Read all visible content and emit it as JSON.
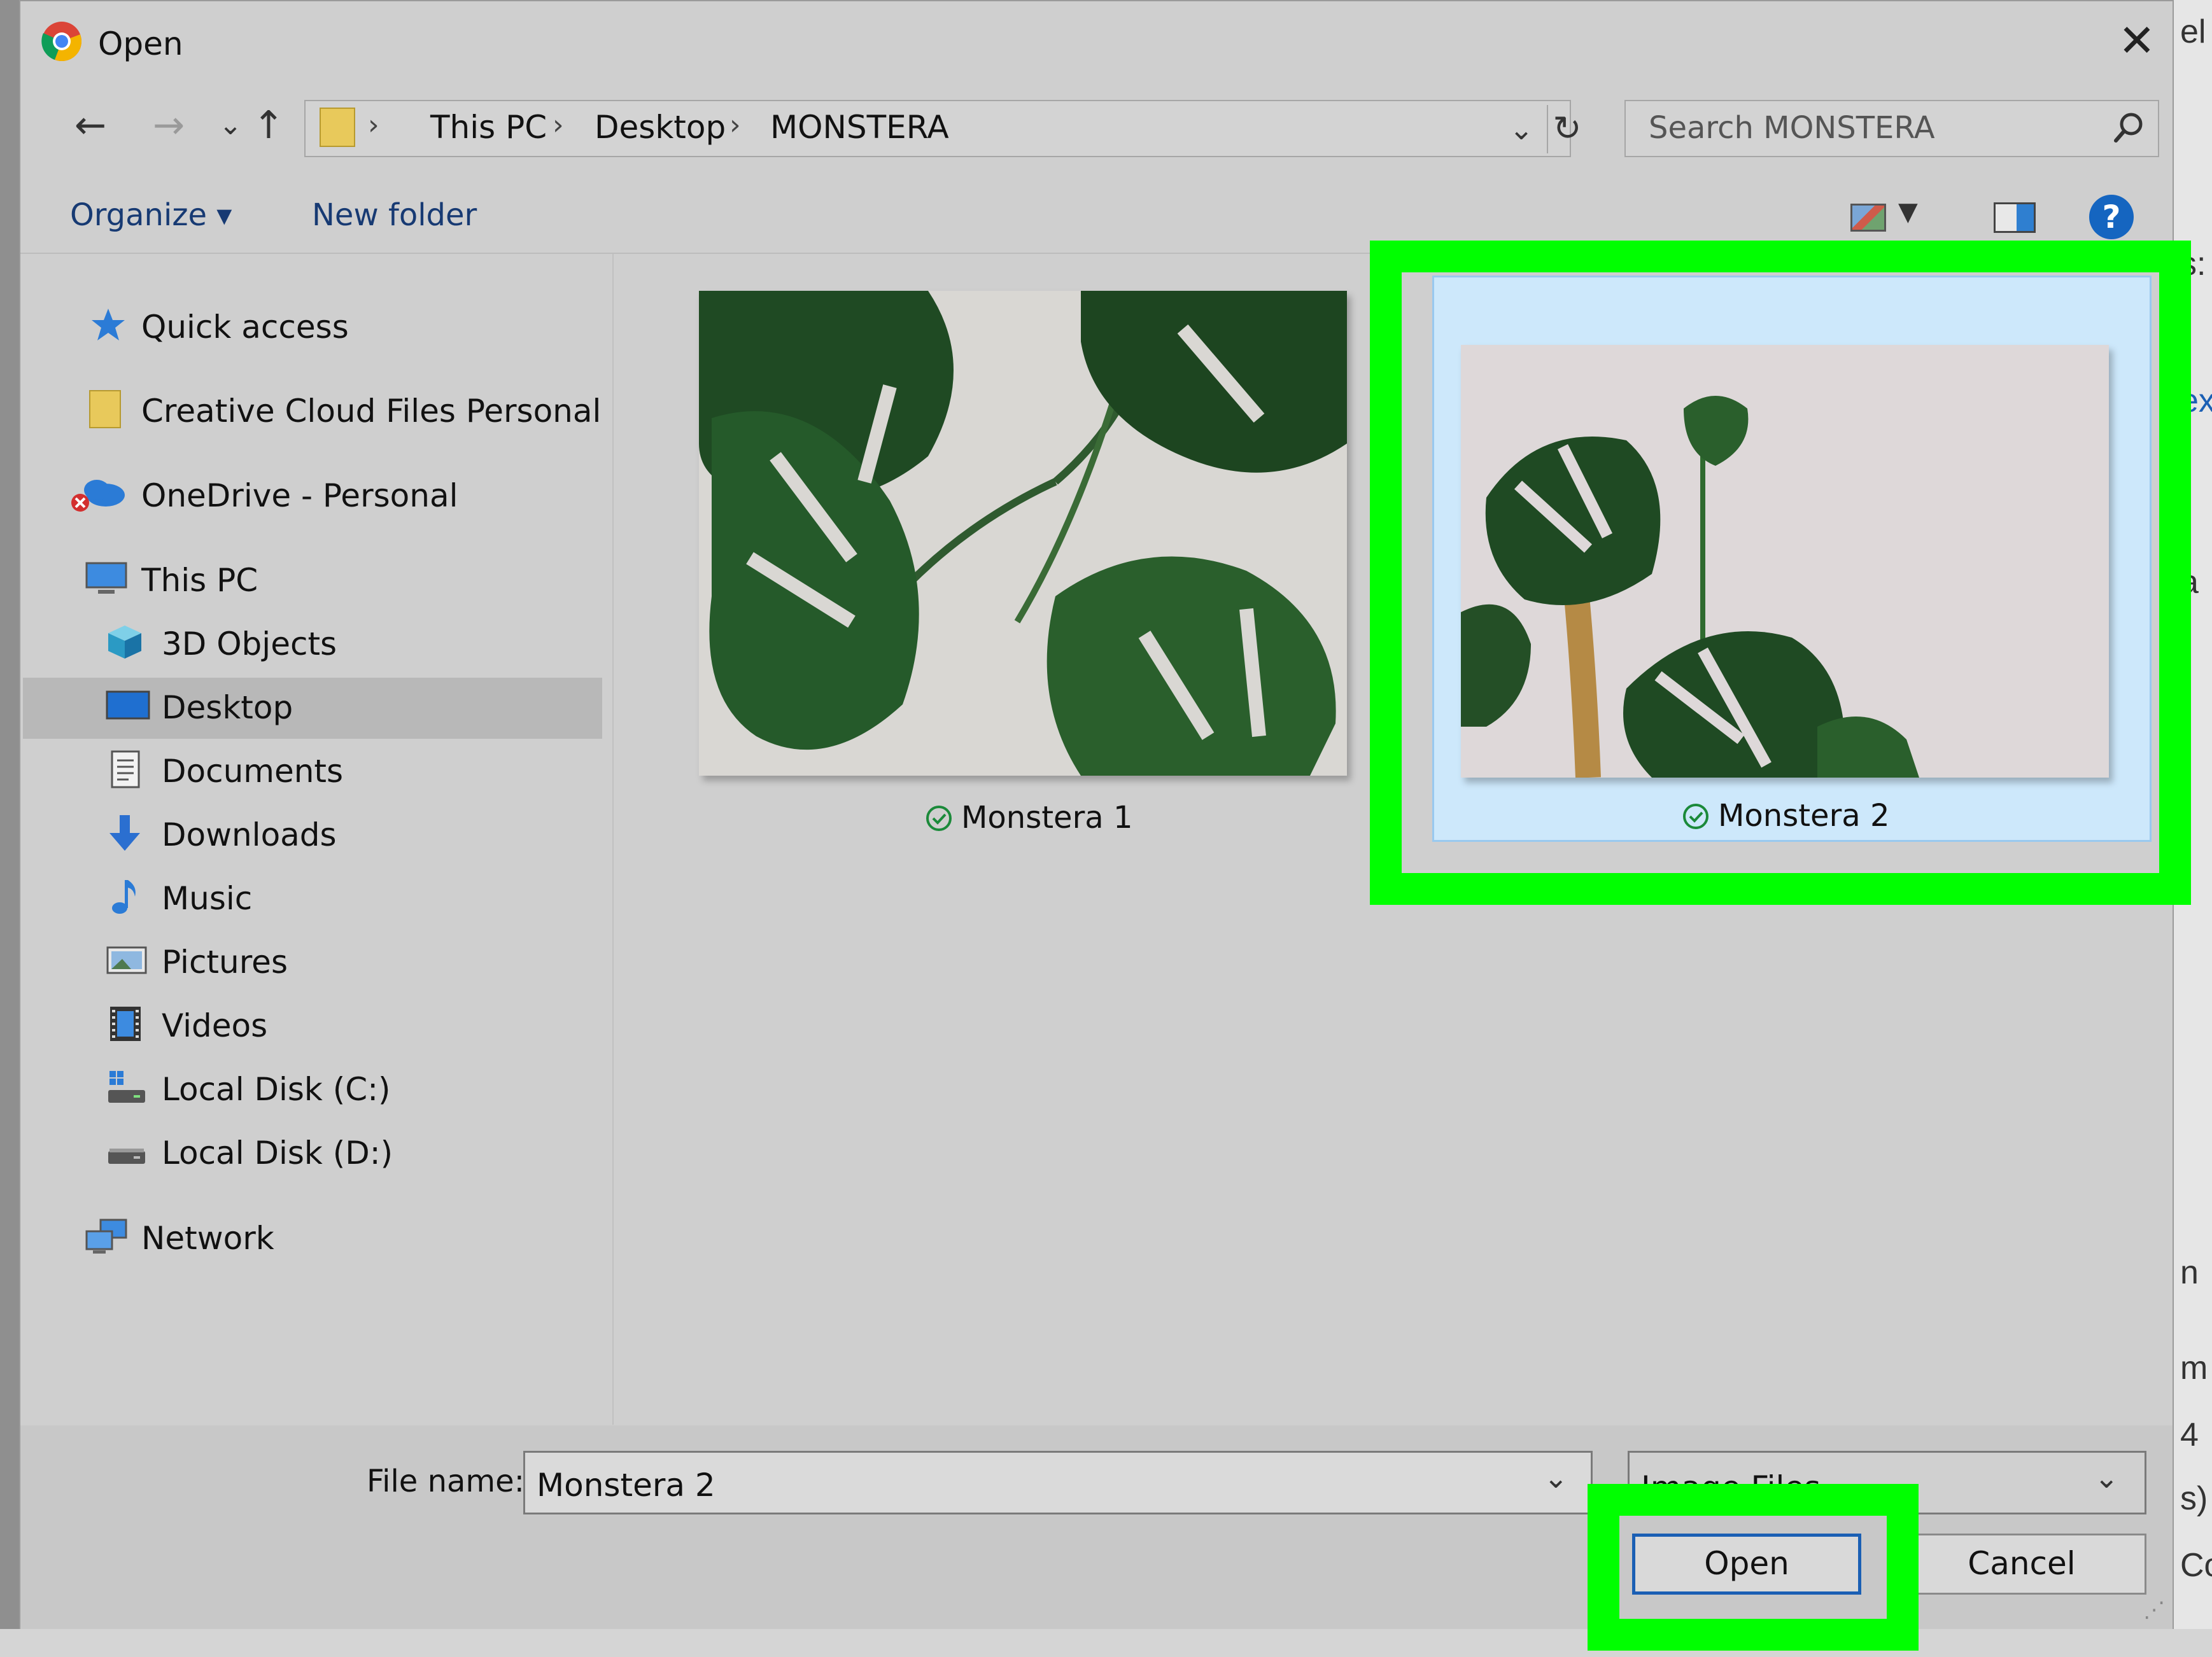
{
  "dialog": {
    "title": "Open",
    "close_glyph": "✕"
  },
  "nav": {
    "back": "←",
    "forward": "→",
    "recent": "⌄",
    "up": "↑",
    "breadcrumbs": [
      "This PC",
      "Desktop",
      "MONSTERA"
    ],
    "sep": "›",
    "dropdown": "⌄",
    "refresh": "↻",
    "search_placeholder": "Search MONSTERA"
  },
  "commands": {
    "organize": "Organize ▾",
    "new_folder": "New folder",
    "view_dd": "▼",
    "help": "?"
  },
  "sidebar": {
    "items": [
      {
        "label": "Quick access",
        "icon": "star-icon"
      },
      {
        "label": "Creative Cloud Files Personal Acc",
        "icon": "folder-icon"
      },
      {
        "label": "OneDrive - Personal",
        "icon": "cloud-icon"
      },
      {
        "label": "This PC",
        "icon": "computer-icon"
      },
      {
        "label": "3D Objects",
        "icon": "cube-icon"
      },
      {
        "label": "Desktop",
        "icon": "desktop-icon",
        "selected": true
      },
      {
        "label": "Documents",
        "icon": "document-icon"
      },
      {
        "label": "Downloads",
        "icon": "download-icon"
      },
      {
        "label": "Music",
        "icon": "music-icon"
      },
      {
        "label": "Pictures",
        "icon": "pictures-icon"
      },
      {
        "label": "Videos",
        "icon": "video-icon"
      },
      {
        "label": "Local Disk (C:)",
        "icon": "drive-icon"
      },
      {
        "label": "Local Disk (D:)",
        "icon": "drive-icon"
      },
      {
        "label": "Network",
        "icon": "network-icon"
      }
    ]
  },
  "files": [
    {
      "name": "Monstera 1",
      "selected": false
    },
    {
      "name": "Monstera 2",
      "selected": true
    }
  ],
  "bottom": {
    "file_name_label": "File name:",
    "file_name_value": "Monstera 2",
    "file_type": "Image Files",
    "open_label": "Open",
    "cancel_label": "Cancel",
    "grip": "⋰"
  },
  "background": {
    "letters": [
      "el",
      "s:",
      "ex",
      "a",
      "n",
      "m",
      "4",
      "s)",
      "Co"
    ]
  },
  "colors": {
    "highlight": "#00ff00",
    "selection": "#cde8fb",
    "accent": "#1a5fb4"
  }
}
